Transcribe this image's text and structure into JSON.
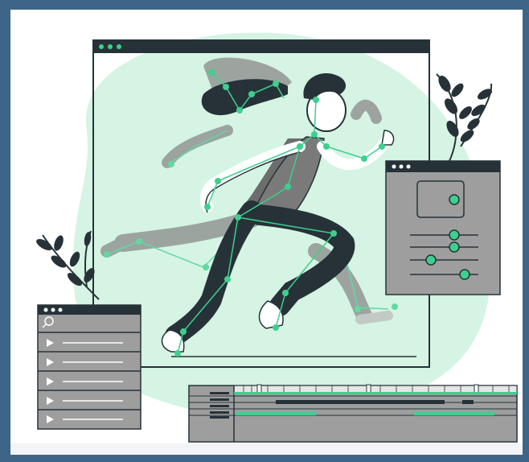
{
  "scene": {
    "subject": "running-woman",
    "icons": [
      "search-icon",
      "play-icon",
      "leaf-icon",
      "window-dots-icon",
      "slider-knob-icon"
    ]
  },
  "colors": {
    "background": "#3d6587",
    "canvas": "#ffffff",
    "blob": "#d5f4e3",
    "accent": "#3ecf8e",
    "dark": "#263238",
    "panel_gray": "#9e9e9e",
    "shadow_gray": "#8a8a8a"
  },
  "media_list": {
    "items_count": 5
  }
}
